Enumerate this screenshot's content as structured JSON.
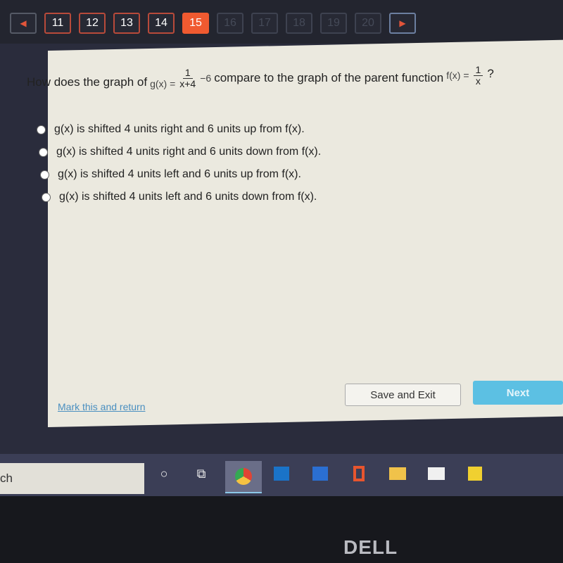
{
  "nav": {
    "items": [
      {
        "label": "11",
        "state": "answered"
      },
      {
        "label": "12",
        "state": "answered"
      },
      {
        "label": "13",
        "state": "answered"
      },
      {
        "label": "14",
        "state": "answered"
      },
      {
        "label": "15",
        "state": "current"
      },
      {
        "label": "16",
        "state": "disabled"
      },
      {
        "label": "17",
        "state": "disabled"
      },
      {
        "label": "18",
        "state": "disabled"
      },
      {
        "label": "19",
        "state": "disabled"
      },
      {
        "label": "20",
        "state": "disabled"
      }
    ],
    "prev_icon": "◀",
    "next_icon": "▶",
    "accent": "#f05a30"
  },
  "question": {
    "prefix": "How does the graph of",
    "g_lhs": "g(x) =",
    "g_num": "1",
    "g_den": "x+4",
    "g_tail": "−6",
    "middle": "compare to the graph of the parent function",
    "f_lhs": "f(x) =",
    "f_num": "1",
    "f_den": "x",
    "suffix": "?"
  },
  "options": [
    "g(x) is shifted 4 units right and 6 units up from f(x).",
    "g(x) is shifted 4 units right and 6 units down from f(x).",
    "g(x) is shifted 4 units left and 6 units up from f(x).",
    "g(x) is shifted 4 units left and 6 units down from f(x)."
  ],
  "footer": {
    "mark": "Mark this and return",
    "save": "Save and Exit",
    "next": "Next"
  },
  "taskbar": {
    "search": "ch",
    "icons": [
      "cortana-icon",
      "task-view-icon",
      "chrome-icon",
      "outlook-icon",
      "word-icon",
      "office-icon",
      "file-explorer-icon",
      "mail-icon",
      "sticky-notes-icon"
    ]
  },
  "brand": "DELL"
}
